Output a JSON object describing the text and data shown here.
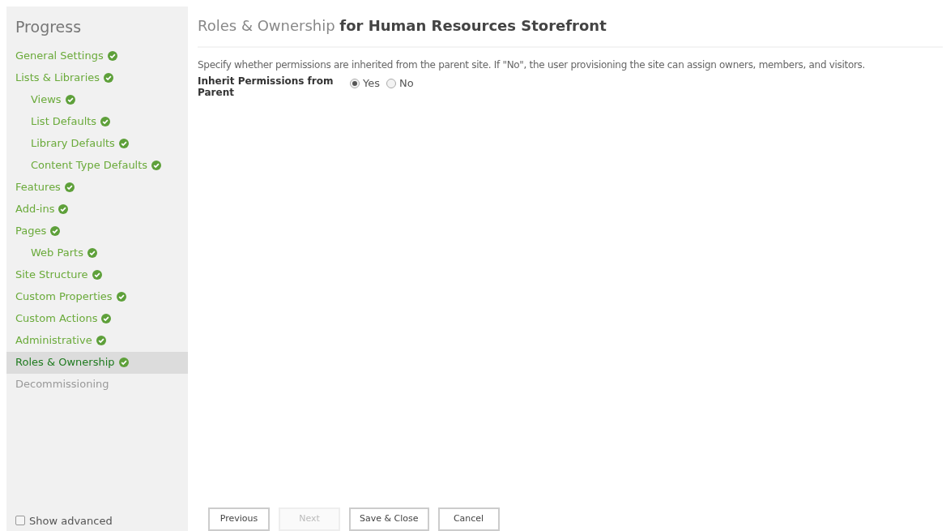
{
  "sidebar": {
    "title": "Progress",
    "items": [
      {
        "label": "General Settings",
        "completed": true,
        "selected": false
      },
      {
        "label": "Lists & Libraries",
        "completed": true,
        "selected": false,
        "children": [
          {
            "label": "Views",
            "completed": true,
            "selected": false
          },
          {
            "label": "List Defaults",
            "completed": true,
            "selected": false
          },
          {
            "label": "Library Defaults",
            "completed": true,
            "selected": false
          },
          {
            "label": "Content Type Defaults",
            "completed": true,
            "selected": false
          }
        ]
      },
      {
        "label": "Features",
        "completed": true,
        "selected": false
      },
      {
        "label": "Add-ins",
        "completed": true,
        "selected": false
      },
      {
        "label": "Pages",
        "completed": true,
        "selected": false,
        "children": [
          {
            "label": "Web Parts",
            "completed": true,
            "selected": false
          }
        ]
      },
      {
        "label": "Site Structure",
        "completed": true,
        "selected": false
      },
      {
        "label": "Custom Properties",
        "completed": true,
        "selected": false
      },
      {
        "label": "Custom Actions",
        "completed": true,
        "selected": false
      },
      {
        "label": "Administrative",
        "completed": true,
        "selected": false
      },
      {
        "label": "Roles & Ownership",
        "completed": true,
        "selected": true
      },
      {
        "label": "Decommissioning",
        "completed": false,
        "selected": false
      }
    ],
    "show_advanced": {
      "label": "Show advanced",
      "checked": false
    }
  },
  "heading": {
    "title": "Roles & Ownership",
    "subject": "for Human Resources Storefront"
  },
  "description": "Specify whether permissions are inherited from the parent site. If \"No\", the user provisioning the site can assign owners, members, and visitors.",
  "field": {
    "label": "Inherit Permissions from Parent",
    "options": [
      {
        "label": "Yes",
        "selected": true
      },
      {
        "label": "No",
        "selected": false
      }
    ]
  },
  "buttons": [
    {
      "label": "Previous",
      "disabled": false
    },
    {
      "label": "Next",
      "disabled": true
    },
    {
      "label": "Save & Close",
      "disabled": false
    },
    {
      "label": "Cancel",
      "disabled": false
    }
  ]
}
